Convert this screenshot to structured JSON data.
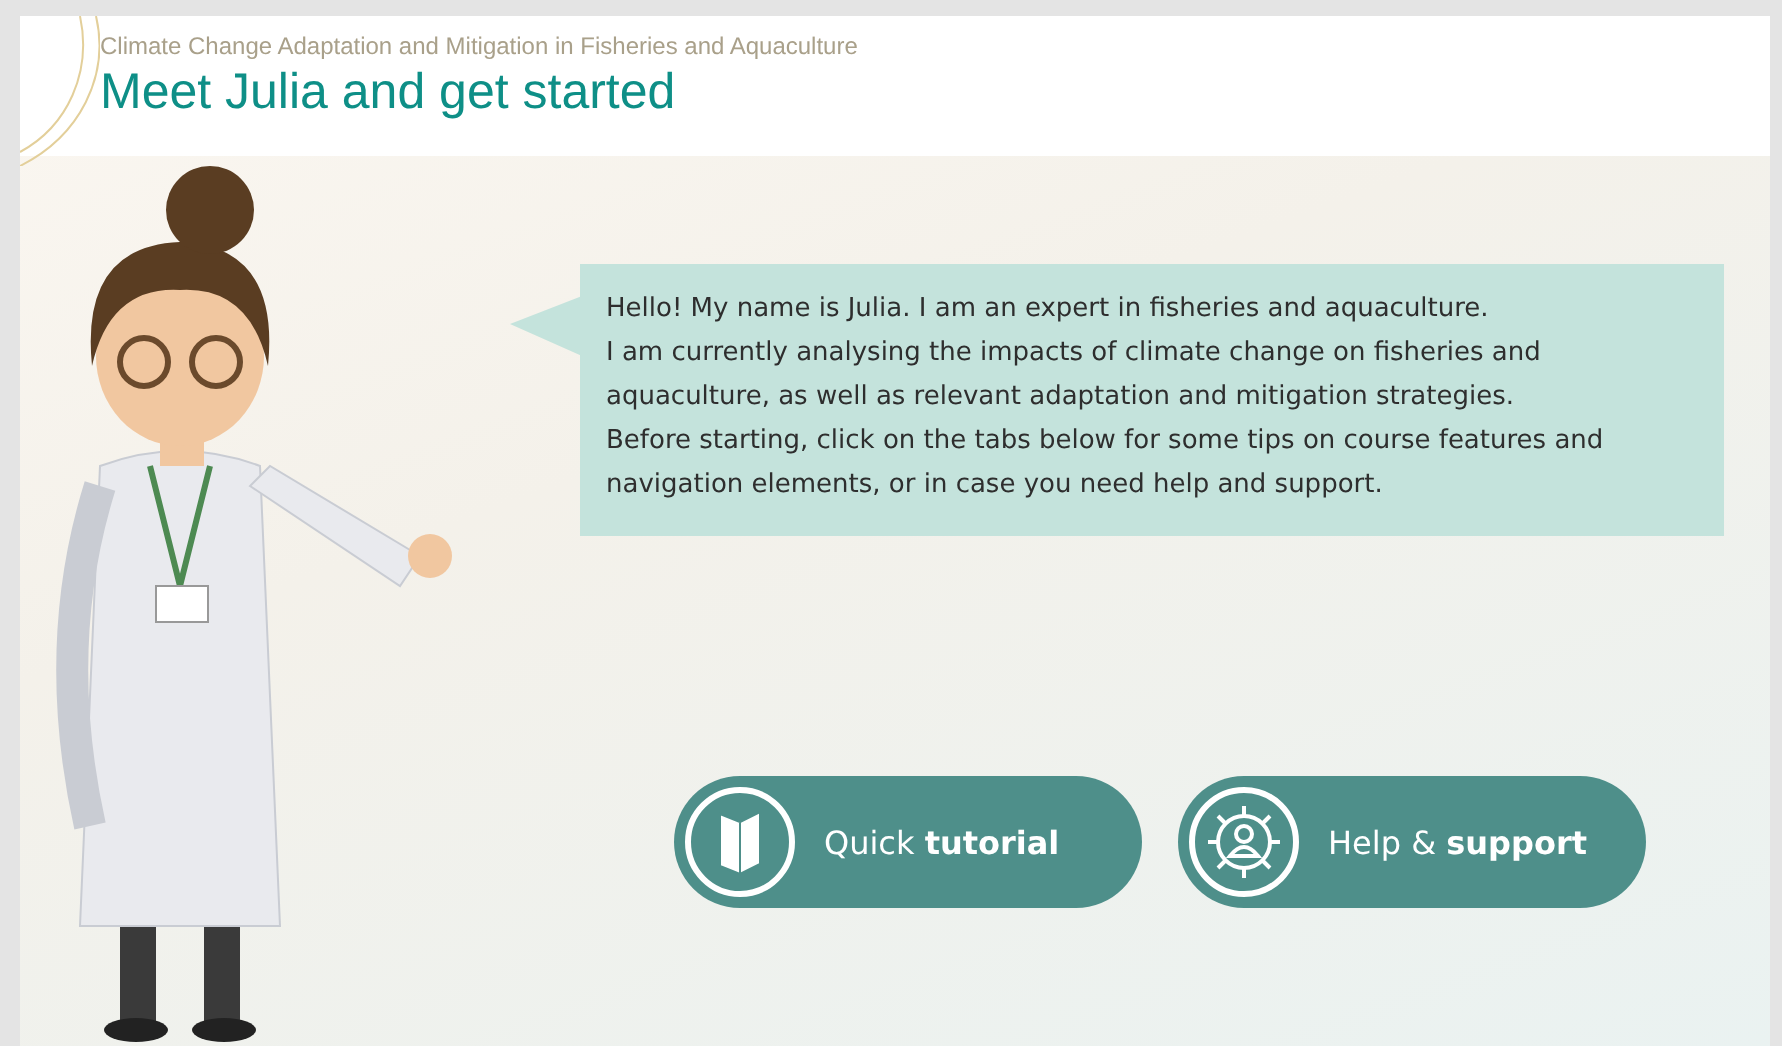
{
  "header": {
    "course_title": "Climate Change Adaptation and Mitigation in Fisheries and Aquaculture",
    "page_title": "Meet Julia and get started"
  },
  "speech_bubble": {
    "lines": [
      "Hello! My name is Julia. I am an expert in fisheries and aquaculture.",
      "I am currently analysing the impacts of climate change on fisheries and aquaculture, as well as relevant adaptation and mitigation strategies.",
      "Before starting, click on the tabs below for some tips on course features and navigation elements, or in case you need help and support."
    ]
  },
  "buttons": [
    {
      "label": "Quick **tutorial**",
      "kind": "book"
    },
    {
      "label": "Help & **support**",
      "kind": "gear"
    }
  ]
}
